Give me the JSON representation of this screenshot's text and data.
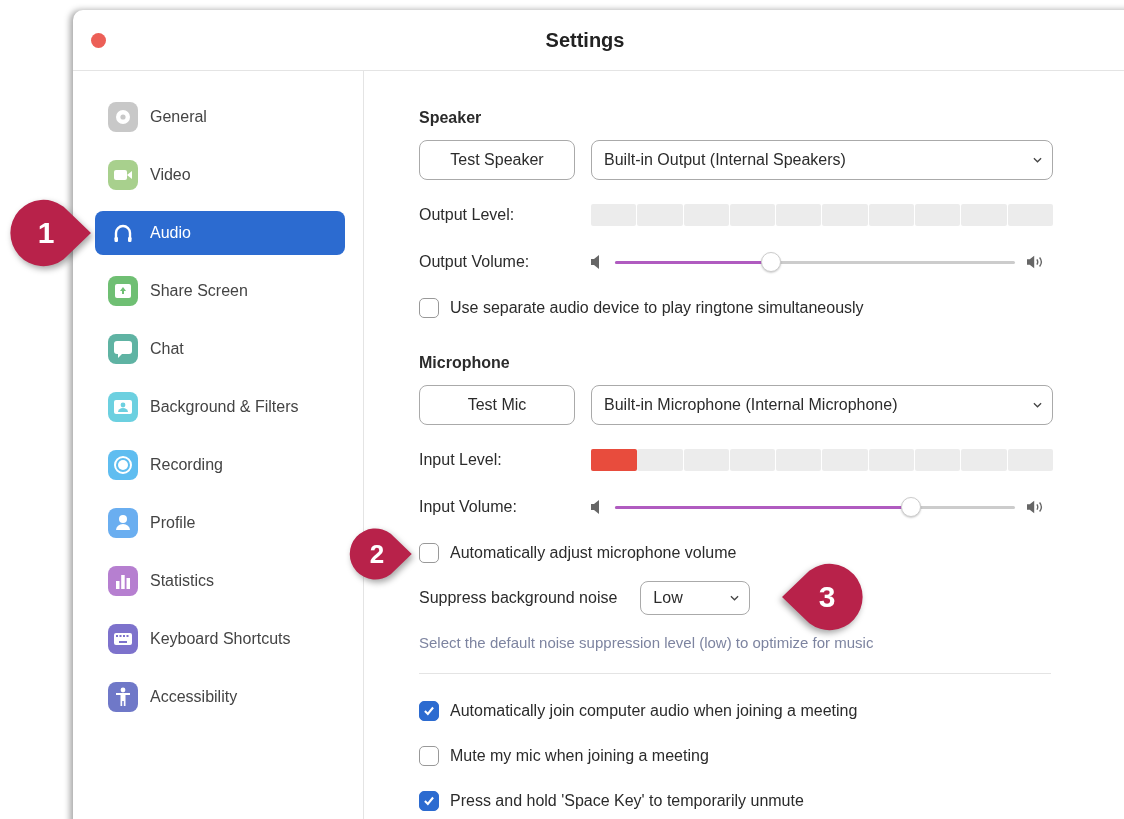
{
  "window": {
    "title": "Settings"
  },
  "sidebar": {
    "items": [
      {
        "label": "General",
        "selected": false,
        "color": "#c8c8c8"
      },
      {
        "label": "Video",
        "selected": false,
        "color": "#a8d08d"
      },
      {
        "label": "Audio",
        "selected": true,
        "color": "#2c6bd0"
      },
      {
        "label": "Share Screen",
        "selected": false,
        "color": "#6fbf73"
      },
      {
        "label": "Chat",
        "selected": false,
        "color": "#5fb3a3"
      },
      {
        "label": "Background & Filters",
        "selected": false,
        "color": "#6cd0e0"
      },
      {
        "label": "Recording",
        "selected": false,
        "color": "#5fbdf0"
      },
      {
        "label": "Profile",
        "selected": false,
        "color": "#6aaef0"
      },
      {
        "label": "Statistics",
        "selected": false,
        "color": "#b67fd0"
      },
      {
        "label": "Keyboard Shortcuts",
        "selected": false,
        "color": "#7d72cc"
      },
      {
        "label": "Accessibility",
        "selected": false,
        "color": "#6f78c8"
      }
    ]
  },
  "speaker": {
    "heading": "Speaker",
    "test_button": "Test Speaker",
    "device": "Built-in Output (Internal Speakers)",
    "level_meter": {
      "label": "Output Level:"
    },
    "volume": {
      "label": "Output Volume:",
      "level": 0.39
    },
    "option": {
      "label": "Use separate audio device to play ringtone simultaneously",
      "checked": false
    }
  },
  "microphone": {
    "heading": "Microphone",
    "test_button": "Test Mic",
    "device": "Built-in Microphone (Internal Microphone)",
    "level_meter": {
      "label": "Input Level:",
      "level": 0.1
    },
    "volume": {
      "label": "Input Volume:",
      "level": 0.74
    },
    "option": {
      "label": "Automatically adjust microphone volume",
      "checked": false
    },
    "suppress": {
      "label": "Suppress background noise",
      "value": "Low"
    },
    "hint": "Select the default noise suppression level (low) to optimize for music"
  },
  "options": [
    {
      "label": "Automatically join computer audio when joining a meeting",
      "checked": true
    },
    {
      "label": "Mute my mic when joining a meeting",
      "checked": false
    },
    {
      "label": "Press and hold 'Space Key' to temporarily unmute",
      "checked": true
    }
  ],
  "callouts": [
    {
      "number": "1"
    },
    {
      "number": "2"
    },
    {
      "number": "3"
    }
  ]
}
